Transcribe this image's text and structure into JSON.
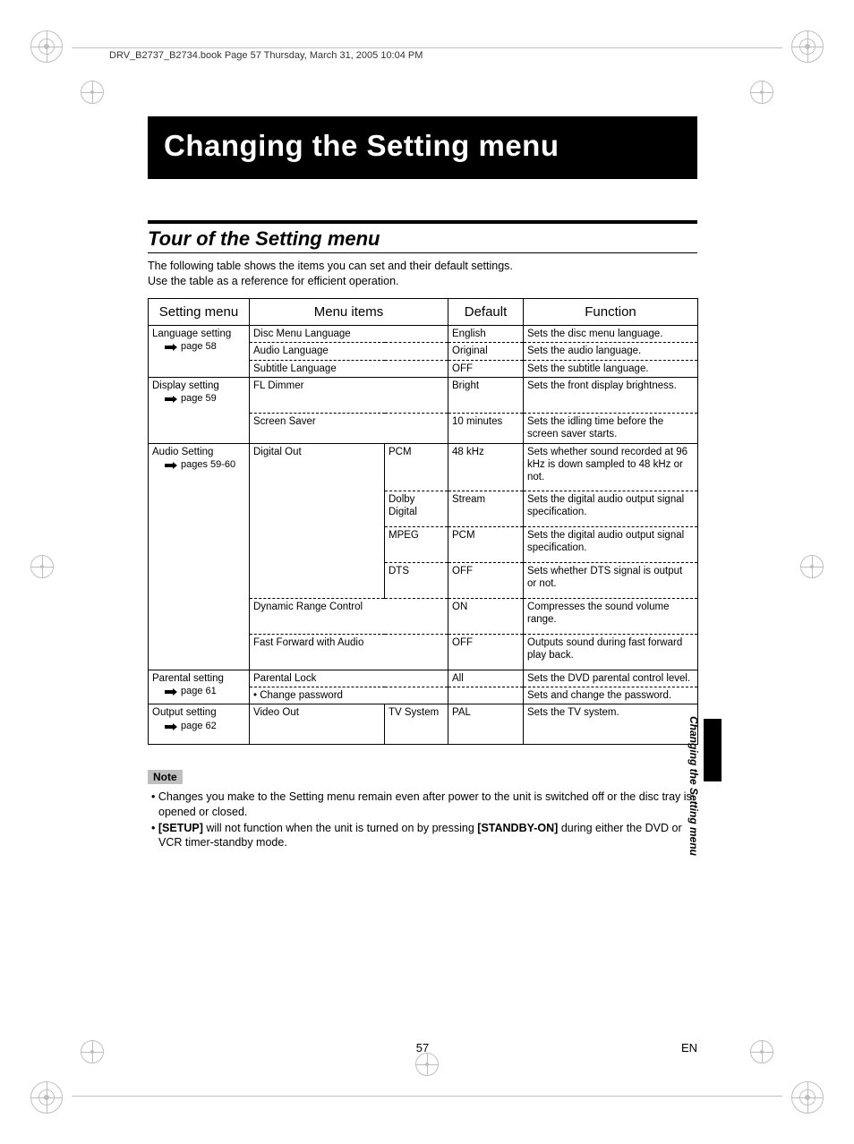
{
  "running_head": "DRV_B2737_B2734.book  Page 57  Thursday, March 31, 2005  10:04 PM",
  "chapter_title": "Changing the Setting menu",
  "section_title": "Tour of the Setting menu",
  "intro_line1": "The following table shows the items you can set and their default settings.",
  "intro_line2": "Use the table as a reference for efficient operation.",
  "headers": {
    "c1": "Setting menu",
    "c2": "Menu items",
    "c3": "Default",
    "c4": "Function"
  },
  "cats": {
    "lang": {
      "name": "Language setting",
      "ref": "page 58"
    },
    "disp": {
      "name": "Display setting",
      "ref": "page 59"
    },
    "audio": {
      "name": "Audio Setting",
      "ref": "pages 59-60"
    },
    "parent": {
      "name": "Parental setting",
      "ref": "page 61"
    },
    "output": {
      "name": "Output setting",
      "ref": "page 62"
    }
  },
  "items": {
    "disc_menu_lang": {
      "name": "Disc Menu Language",
      "def": "English",
      "fn": "Sets the disc menu language."
    },
    "audio_lang": {
      "name": "Audio Language",
      "def": "Original",
      "fn": "Sets the audio language."
    },
    "subtitle_lang": {
      "name": "Subtitle Language",
      "def": "OFF",
      "fn": "Sets the subtitle language."
    },
    "fl_dimmer": {
      "name": "FL Dimmer",
      "def": "Bright",
      "fn": "Sets the front display brightness."
    },
    "screen_saver": {
      "name": "Screen Saver",
      "def": "10 minutes",
      "fn": "Sets the idling time before the screen saver starts."
    },
    "digital_out": {
      "name": "Digital Out"
    },
    "pcm": {
      "sub": "PCM",
      "def": "48 kHz",
      "fn": "Sets whether sound recorded at 96 kHz is down sampled to 48 kHz or not."
    },
    "dolby": {
      "sub": "Dolby Digital",
      "def": "Stream",
      "fn": "Sets the digital audio output signal specification."
    },
    "mpeg": {
      "sub": "MPEG",
      "def": "PCM",
      "fn": "Sets the digital audio output signal specification."
    },
    "dts": {
      "sub": "DTS",
      "def": "OFF",
      "fn": "Sets whether DTS signal is output or not."
    },
    "drc": {
      "name": "Dynamic Range Control",
      "def": "ON",
      "fn": "Compresses the sound volume range."
    },
    "ffwd_audio": {
      "name": "Fast Forward with Audio",
      "def": "OFF",
      "fn": "Outputs sound during fast forward play back."
    },
    "parental_lock": {
      "name": "Parental Lock",
      "def": "All",
      "fn": "Sets the DVD parental control level."
    },
    "change_password": {
      "name": "• Change password",
      "def": "",
      "fn": "Sets and change the password."
    },
    "video_out": {
      "name": "Video Out",
      "sub": "TV System",
      "def": "PAL",
      "fn": "Sets the TV system."
    }
  },
  "note_label": "Note",
  "notes": {
    "n1": "Changes you make to the Setting menu remain even after power to the unit is switched off or the disc tray is opened or closed.",
    "n2_a": "[SETUP]",
    "n2_b": " will not function when the unit is turned on by pressing ",
    "n2_c": "[STANDBY-ON]",
    "n2_d": " during either the DVD or VCR timer-standby mode."
  },
  "side_label": "Changing the Setting menu",
  "page_number": "57",
  "lang_code": "EN"
}
